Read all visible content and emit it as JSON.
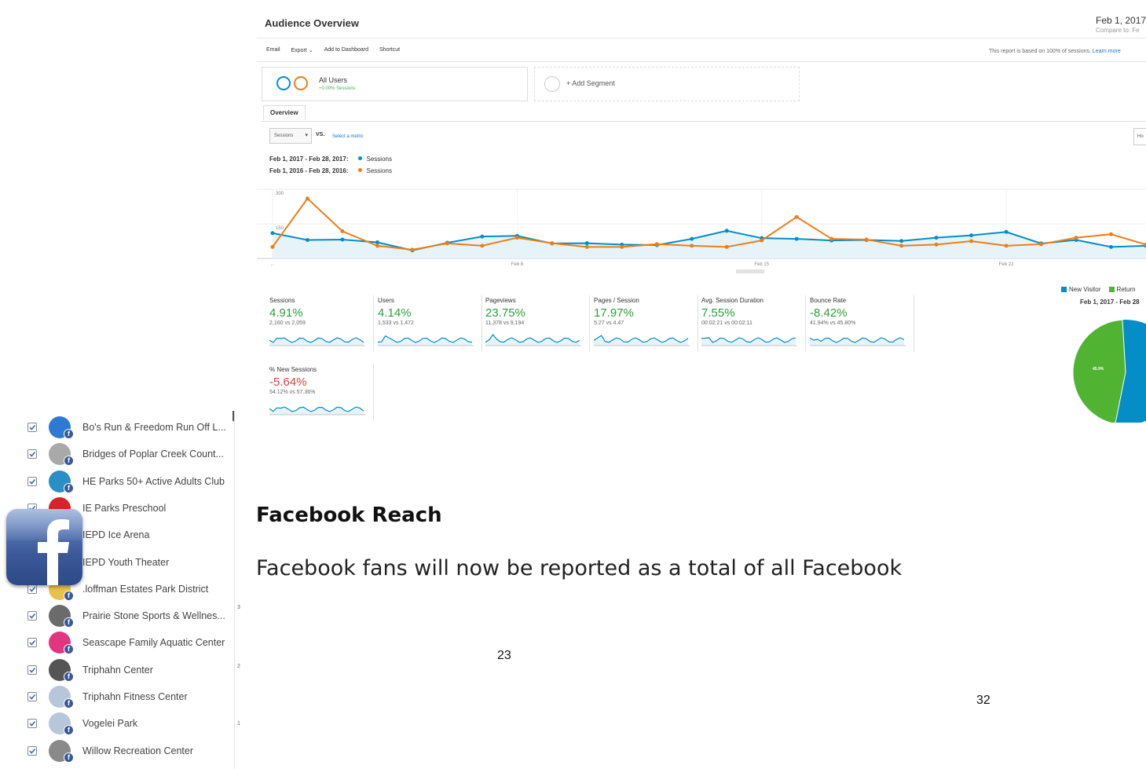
{
  "analytics": {
    "title": "Audience Overview",
    "date_range": "Feb 1, 2017",
    "compare_label": "Compare to: Fe",
    "toolbar": {
      "email": "Email",
      "export": "Export",
      "add_to_dashboard": "Add to Dashboard",
      "shortcut": "Shortcut"
    },
    "report_note": "This report is based on 100% of sessions.",
    "learn_more": "Learn more",
    "segment_all_users": "All Users",
    "segment_all_users_sub": "+0.00% Sessions",
    "add_segment": "+ Add Segment",
    "tab_overview": "Overview",
    "metric_select": "Sessions",
    "vs_label": "VS.",
    "select_metric": "Select a metric",
    "hourly_button": "Ho",
    "legend": [
      {
        "range": "Feb 1, 2017 - Feb 28, 2017:",
        "series": "Sessions",
        "color": "#058dc7"
      },
      {
        "range": "Feb 1, 2016 - Feb 28, 2016:",
        "series": "Sessions",
        "color": "#ed7e17"
      }
    ],
    "metrics": [
      {
        "name": "Sessions",
        "change": "4.91%",
        "compare": "2,160 vs 2,059",
        "color": "#2e9e3c"
      },
      {
        "name": "Users",
        "change": "4.14%",
        "compare": "1,533 vs 1,472",
        "color": "#2e9e3c"
      },
      {
        "name": "Pageviews",
        "change": "23.75%",
        "compare": "11,378 vs 9,194",
        "color": "#2e9e3c"
      },
      {
        "name": "Pages / Session",
        "change": "17.97%",
        "compare": "5.27 vs 4.47",
        "color": "#2e9e3c"
      },
      {
        "name": "Avg. Session Duration",
        "change": "7.55%",
        "compare": "00:02:21 vs 00:02:11",
        "color": "#2e9e3c"
      },
      {
        "name": "Bounce Rate",
        "change": "-8.42%",
        "compare": "41.94% vs 45.80%",
        "color": "#2e9e3c"
      },
      {
        "name": "% New Sessions",
        "change": "-5.64%",
        "compare": "54.12% vs 57.36%",
        "color": "#d9453d"
      }
    ],
    "pie": {
      "legend_new": "New Visitor",
      "legend_returning": "Return",
      "date": "Feb 1, 2017 - Feb 28",
      "returning_label": "45.9%",
      "returning_fraction": 0.459,
      "new_color": "#058dc7",
      "returning_color": "#50b432"
    }
  },
  "chart_data": {
    "type": "line",
    "x": [
      "Feb 1",
      "Feb 2",
      "Feb 3",
      "Feb 4",
      "Feb 5",
      "Feb 6",
      "Feb 7",
      "Feb 8",
      "Feb 9",
      "Feb 10",
      "Feb 11",
      "Feb 12",
      "Feb 13",
      "Feb 14",
      "Feb 15",
      "Feb 16",
      "Feb 17",
      "Feb 18",
      "Feb 19",
      "Feb 20",
      "Feb 21",
      "Feb 22",
      "Feb 23",
      "Feb 24",
      "Feb 25",
      "Feb 26"
    ],
    "x_tick_labels": [
      "...",
      "Feb 8",
      "Feb 15",
      "Feb 22"
    ],
    "y_tick_labels": [
      "300",
      "150"
    ],
    "ylim": [
      0,
      300
    ],
    "series": [
      {
        "name": "Sessions",
        "color": "#058dc7",
        "values": [
          110,
          80,
          82,
          70,
          35,
          68,
          95,
          98,
          65,
          66,
          60,
          58,
          85,
          120,
          88,
          85,
          78,
          80,
          76,
          90,
          100,
          115,
          65,
          80,
          50,
          55
        ]
      },
      {
        "name": "Sessions",
        "color": "#ed7e17",
        "values": [
          50,
          260,
          118,
          55,
          38,
          65,
          55,
          90,
          66,
          50,
          50,
          62,
          55,
          50,
          78,
          180,
          85,
          82,
          55,
          60,
          75,
          55,
          62,
          90,
          105,
          60
        ]
      }
    ]
  },
  "facebook_pages": [
    {
      "name": "Bo's Run & Freedom Run Off L...",
      "color": "#2d7bd0"
    },
    {
      "name": "Bridges of Poplar Creek Count...",
      "color": "#a9a9a9"
    },
    {
      "name": "HE Parks 50+ Active Adults Club",
      "color": "#2a8fc4"
    },
    {
      "name": "IE Parks Preschool",
      "color": "#d8232a"
    },
    {
      "name": "IEPD Ice Arena",
      "color": "#5a7fb0"
    },
    {
      "name": "IEPD Youth Theater",
      "color": "#333333"
    },
    {
      "name": ".loffman Estates Park District",
      "color": "#e6c24a"
    },
    {
      "name": "Prairie Stone Sports & Wellnes...",
      "color": "#6b6b6b"
    },
    {
      "name": "Seascape Family Aquatic Center",
      "color": "#e0357f"
    },
    {
      "name": "Triphahn Center",
      "color": "#555555"
    },
    {
      "name": "Triphahn Fitness Center",
      "color": "#b8c6d9"
    },
    {
      "name": "Vogelei Park",
      "color": "#b8c6d9"
    },
    {
      "name": "Willow Recreation Center",
      "color": "#8a8a8a"
    }
  ],
  "side_ticks": [
    "3",
    "2",
    "1"
  ],
  "section": {
    "heading": "Facebook Reach",
    "paragraph": "Facebook fans will now be reported as a total of all Facebook",
    "page_num_a": "23",
    "page_num_b": "32"
  }
}
